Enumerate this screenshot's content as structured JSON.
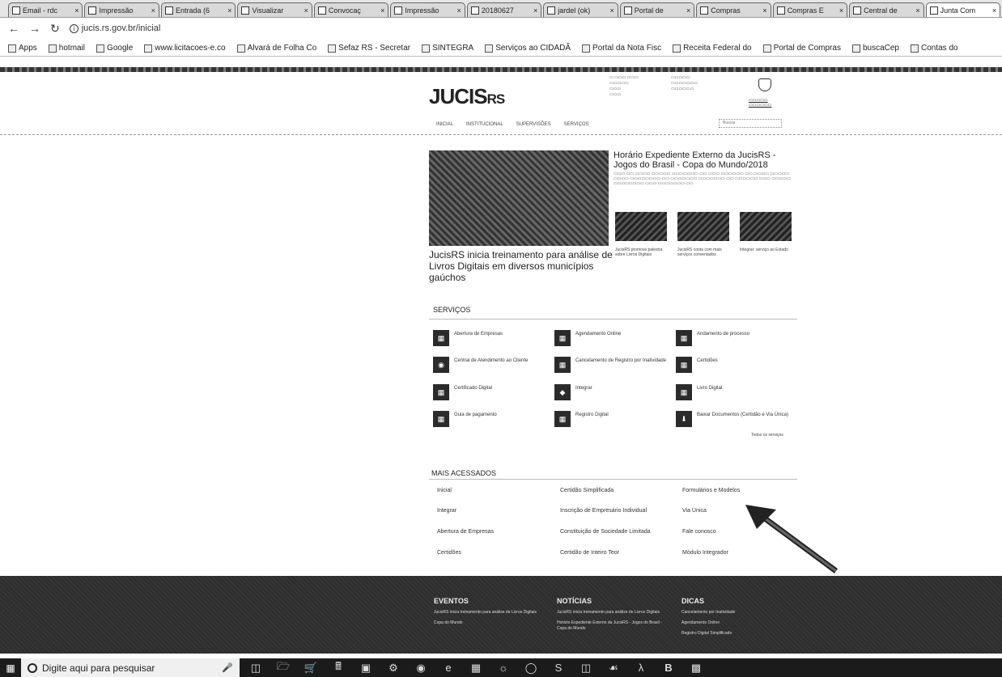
{
  "browser": {
    "tabs": [
      {
        "label": "Email - rdc"
      },
      {
        "label": "Impressão"
      },
      {
        "label": "Entrada (6"
      },
      {
        "label": "Visualizar"
      },
      {
        "label": "Convocaç"
      },
      {
        "label": "Impressão"
      },
      {
        "label": "20180627"
      },
      {
        "label": "jardel (ok)"
      },
      {
        "label": "Portal de"
      },
      {
        "label": "Compras"
      },
      {
        "label": "Compras E"
      },
      {
        "label": "Central de"
      },
      {
        "label": "Junta Com",
        "active": true
      }
    ],
    "url": "jucis.rs.gov.br/inicial",
    "bookmarks": [
      {
        "label": "Apps"
      },
      {
        "label": "hotmail"
      },
      {
        "label": "Google"
      },
      {
        "label": "www.licitacoes-e.co"
      },
      {
        "label": "Alvará de Folha Co"
      },
      {
        "label": "Sefaz RS - Secretar"
      },
      {
        "label": "SINTEGRA"
      },
      {
        "label": "Serviços ao CIDADÃ"
      },
      {
        "label": "Portal da Nota Fisc"
      },
      {
        "label": "Receita Federal do"
      },
      {
        "label": "Portal de Compras"
      },
      {
        "label": "buscaCep"
      },
      {
        "label": "Contas do"
      }
    ]
  },
  "site": {
    "logo_main": "JUCIS",
    "logo_rs": "RS",
    "search_placeholder": "Buscar",
    "nav": [
      "INICIAL",
      "INSTITUCIONAL",
      "SUPERVISÕES",
      "SERVIÇOS"
    ],
    "featured": {
      "title": "JucisRS inicia treinamento para análise de Livros Digitais em diversos municípios gaúchos"
    },
    "side_news": {
      "title": "Horário Expediente Externo da JucisRS - Jogos do Brasil - Copa do Mundo/2018",
      "captions": [
        "JucisRS promove palestra sobre Livros Digitais",
        "JucisRS conta com mais serviços conveniados",
        "Integrar: serviço ao Estado"
      ]
    },
    "services": {
      "title": "SERVIÇOS",
      "items": [
        "Abertura de Empresas",
        "Agendamento Online",
        "Andamento de processo",
        "Central de Atendimento ao Cliente",
        "Cancelamento de Registro por Inatividade",
        "Certidões",
        "Certificado Digital",
        "Integrar",
        "Livro Digital",
        "Guia de pagamento",
        "Registro Digital",
        "Baixar Documentos (Certidão e Via Única)"
      ],
      "all_label": "Todos os serviços"
    },
    "most_accessed": {
      "title": "MAIS ACESSADOS",
      "items": [
        "Inicial",
        "Certidão Simplificada",
        "Formulários e Modelos",
        "Integrar",
        "Inscrição de Empresário Individual",
        "Via Única",
        "Abertura de Empresas",
        "Constituição de Sociedade Limitada",
        "Fale conosco",
        "Certidões",
        "Certidão de Inteiro Teor",
        "Módulo Integrador"
      ]
    },
    "footer": {
      "events_title": "EVENTOS",
      "events_items": [
        "JucisRS inicia treinamento para análise de Livros Digitais",
        "Copa do Mundo"
      ],
      "news_title": "NOTÍCIAS",
      "news_items": [
        "JucisRS inicia treinamento para análise de Livros Digitais",
        "Horário Expediente Externo da JucisRS - Jogos do Brasil - Copa do Mundo"
      ],
      "tips_title": "DICAS",
      "tips_items": [
        "Cancelamento por Inatividade",
        "Agendamento Online",
        "Registro Digital Simplificado"
      ]
    }
  },
  "taskbar": {
    "search_placeholder": "Digite aqui para pesquisar"
  }
}
